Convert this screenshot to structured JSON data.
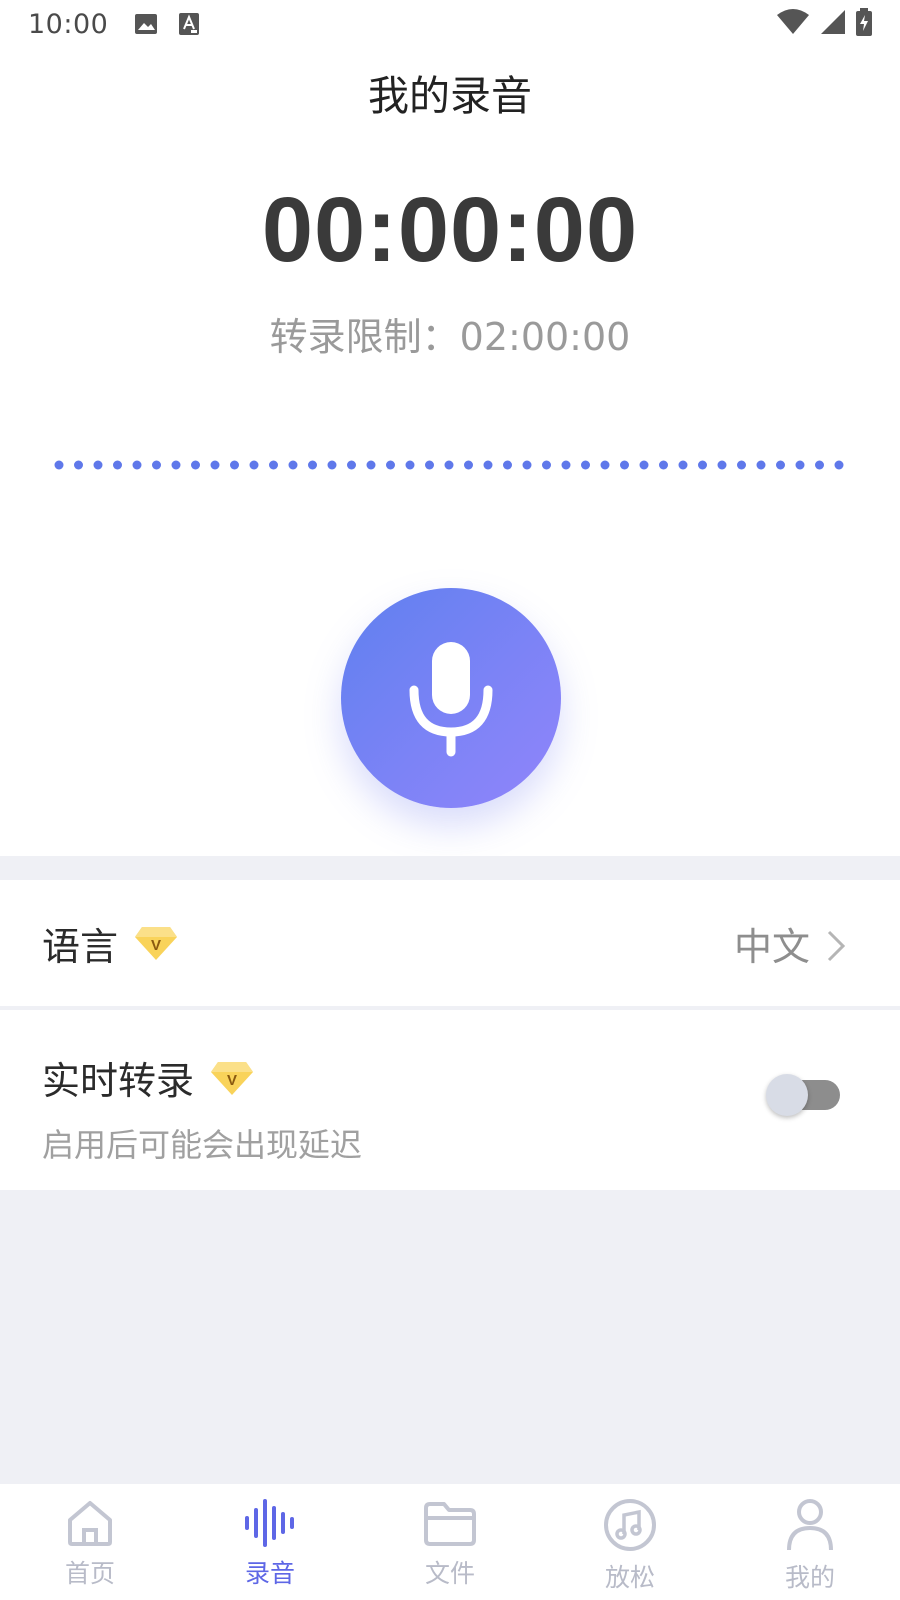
{
  "status_bar": {
    "time": "10:00",
    "icons_left": [
      "image-icon",
      "text-a-icon"
    ],
    "icons_right": [
      "wifi-icon",
      "signal-icon",
      "battery-icon"
    ]
  },
  "header": {
    "title": "我的录音"
  },
  "recorder": {
    "timer": "00:00:00",
    "limit_text": "转录限制：02:00:00",
    "mic_icon": "microphone-icon"
  },
  "settings": {
    "language": {
      "label": "语言",
      "value": "中文",
      "vip_text": "V"
    },
    "realtime": {
      "label": "实时转录",
      "subtitle": "启用后可能会出现延迟",
      "vip_text": "V",
      "enabled": false
    }
  },
  "bottom_nav": {
    "items": [
      {
        "label": "首页",
        "icon": "home-icon",
        "active": false
      },
      {
        "label": "录音",
        "icon": "waveform-icon",
        "active": true
      },
      {
        "label": "文件",
        "icon": "folder-icon",
        "active": false
      },
      {
        "label": "放松",
        "icon": "music-note-icon",
        "active": false
      },
      {
        "label": "我的",
        "icon": "person-icon",
        "active": false
      }
    ]
  },
  "colors": {
    "accent": "#5e67e6",
    "mic_gradient_start": "#5f80ef",
    "mic_gradient_end": "#9185fb",
    "vip_gold": "#f7c43b",
    "inactive_nav": "#b8bbc8",
    "section_bg": "#eff0f5"
  }
}
